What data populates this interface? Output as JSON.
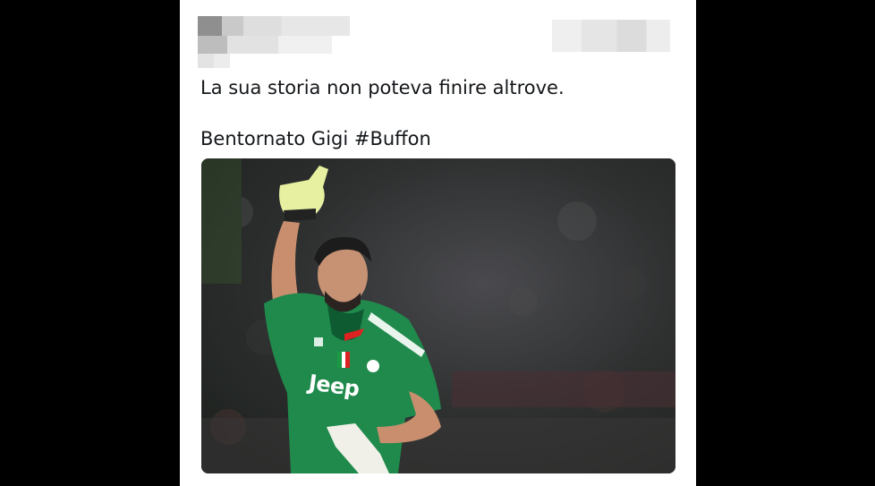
{
  "tweet": {
    "author_name": "",
    "author_handle": "",
    "timestamp": "",
    "text_line1": "La sua storia non poteva finire altrove.",
    "text_line2": "Bentornato Gigi #Buffon",
    "media": {
      "shirt_text": "Jeep",
      "icon": "photo-icon"
    }
  },
  "colors": {
    "page_background": "#000000",
    "card_background": "#ffffff",
    "text": "#14171a",
    "jersey_green": "#1f8a4c"
  }
}
